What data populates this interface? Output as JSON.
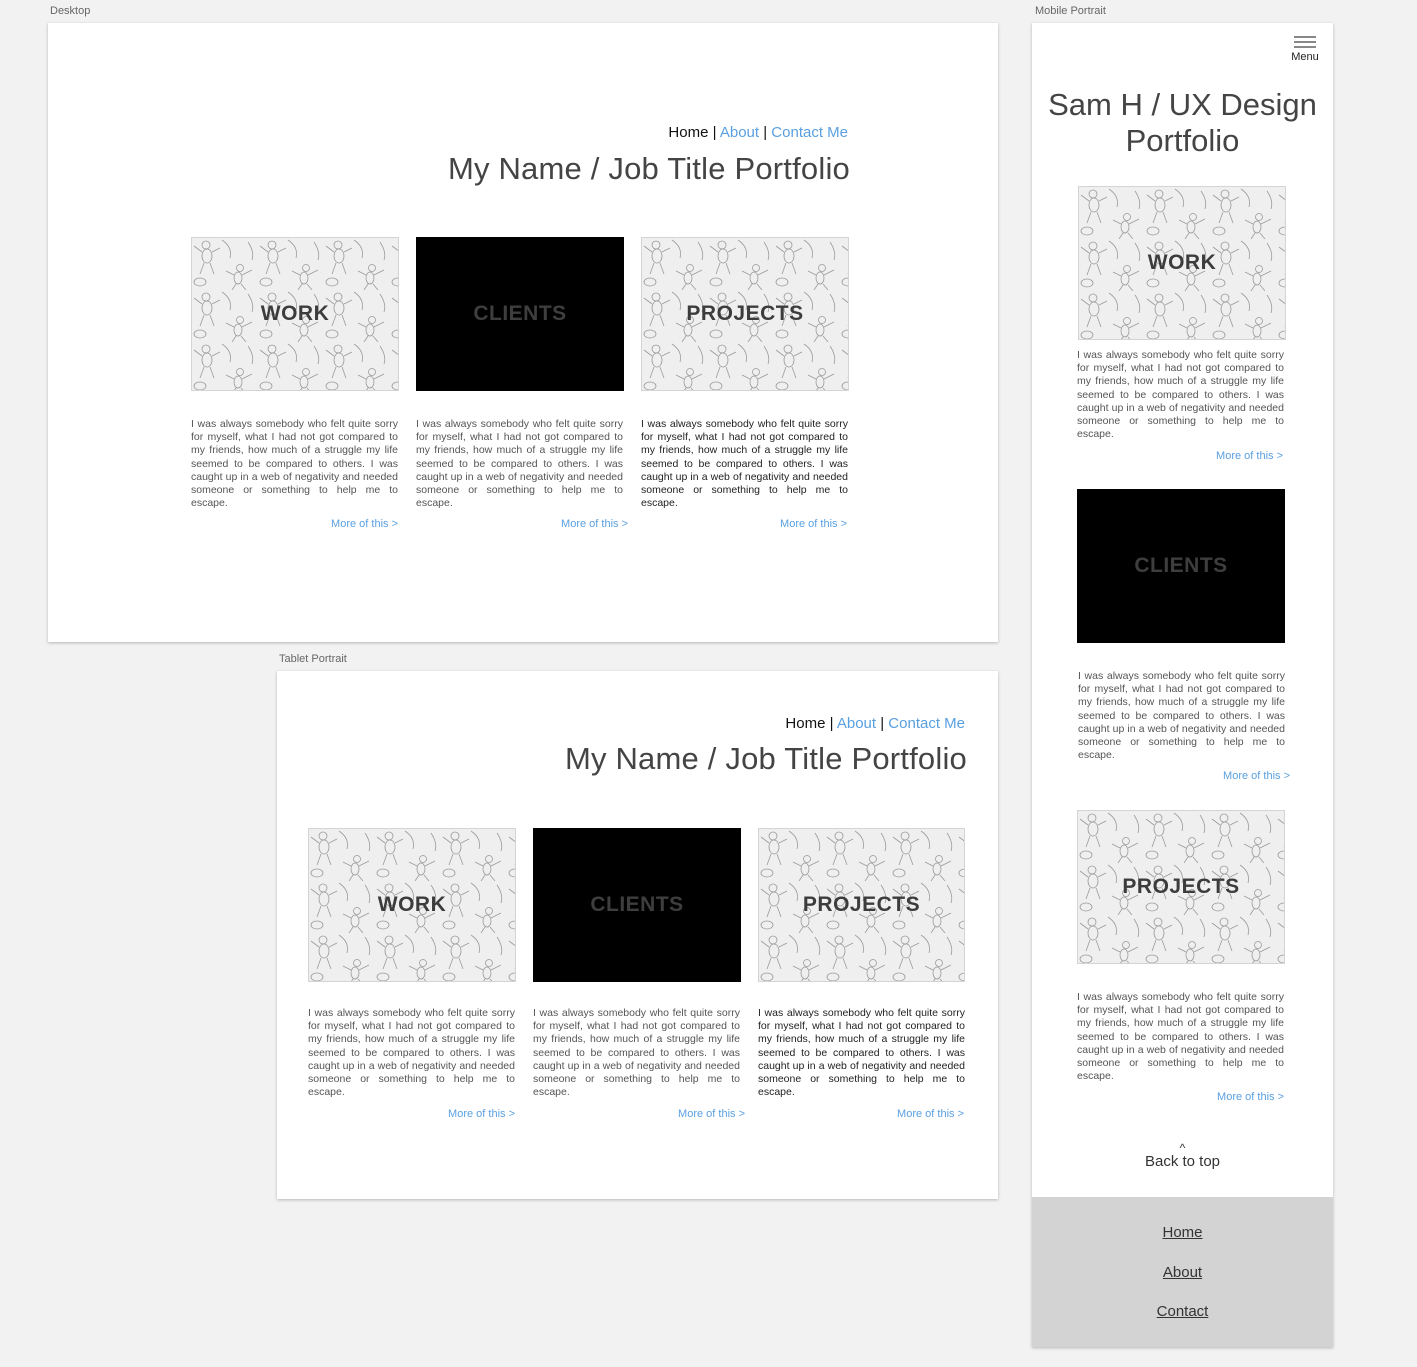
{
  "artboards": {
    "desktop_label": "Desktop",
    "mobile_label": "Mobile Portrait",
    "tablet_label": "Tablet Portrait"
  },
  "nav": {
    "home": "Home",
    "about": "About",
    "contact": "Contact Me",
    "separator": "|"
  },
  "site_title": "My Name / Job Title Portfolio",
  "tiles": {
    "work": "WORK",
    "clients": "CLIENTS",
    "projects": "PROJECTS"
  },
  "description": "I was always somebody who felt quite sorry for myself, what I had not got compared to my friends, how much of a struggle my life seemed to be compared to others. I was caught up in a web of negativity and needed someone or something to help me to escape.",
  "more_link": "More of this >",
  "mobile": {
    "menu_label": "Menu",
    "title": "Sam H / UX Design Portfolio",
    "back_to_top": "Back to top",
    "caret": "^",
    "footer_links": [
      "Home",
      "About",
      "Contact"
    ]
  },
  "colors": {
    "link": "#5aa0e0",
    "canvas": "#f2f2f2",
    "footer": "#d3d3d3"
  }
}
